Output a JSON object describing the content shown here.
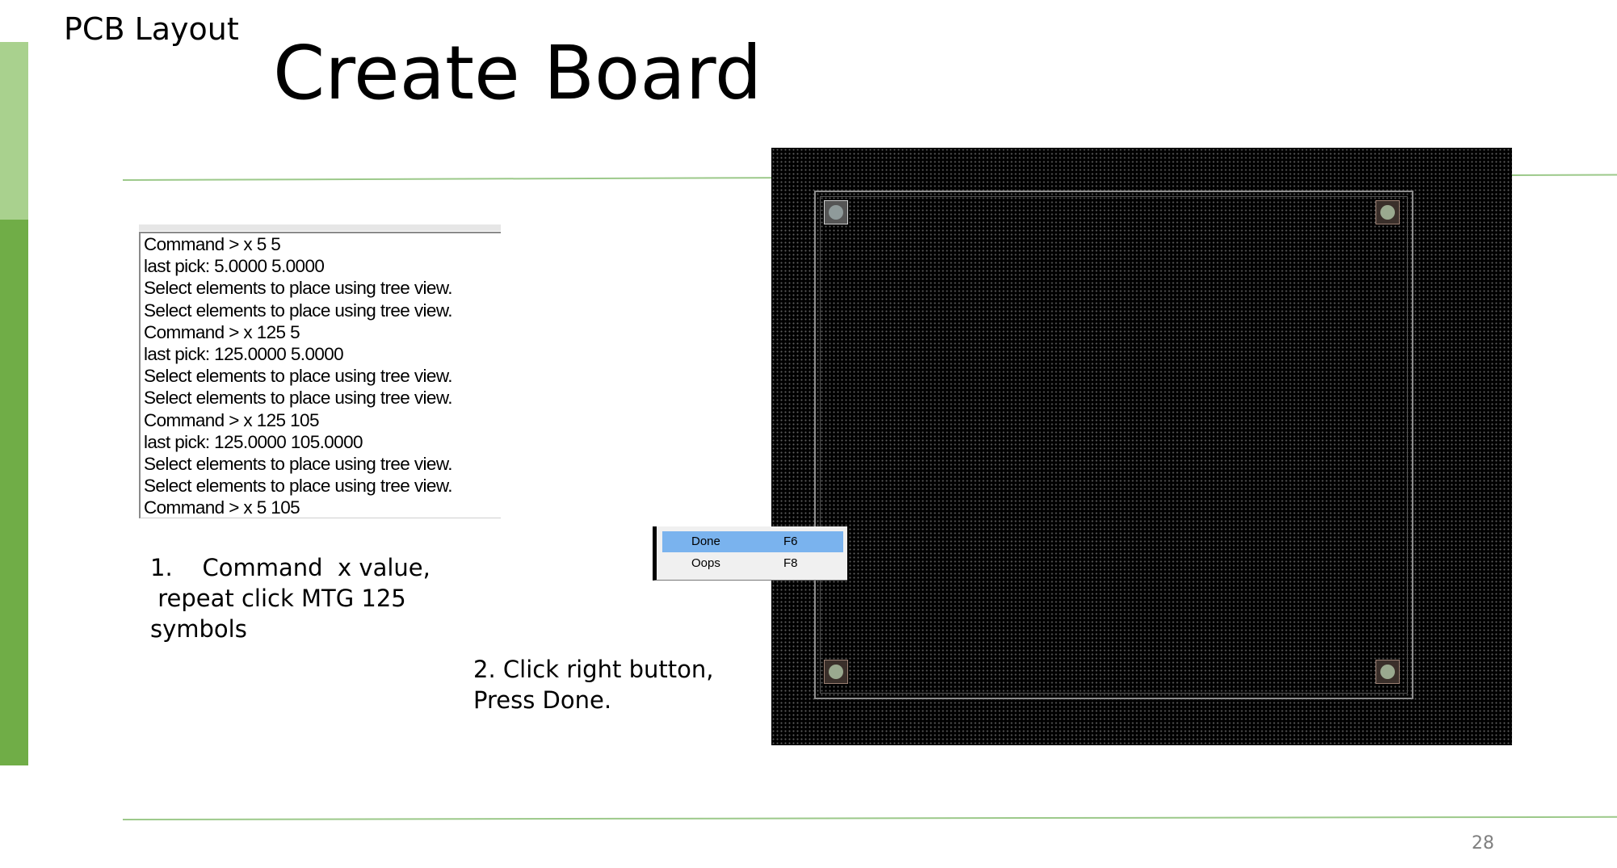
{
  "slide": {
    "header_label": "PCB Layout",
    "title": "Create Board",
    "page_number": "28"
  },
  "command_window": {
    "lines": [
      "Command > x 5 5",
      "last pick:  5.0000 5.0000",
      "Select elements to place using tree view.",
      "Select elements to place using tree view.",
      "Command > x 125 5",
      "last pick:  125.0000 5.0000",
      "Select elements to place using tree view.",
      "Select elements to place using tree view.",
      "Command > x 125 105",
      "last pick:  125.0000 105.0000",
      "Select elements to place using tree view.",
      "Select elements to place using tree view.",
      "Command > x 5 105"
    ]
  },
  "steps": {
    "step1": {
      "line1": "1.    Command  x value,",
      "line2": " repeat click MTG 125",
      "line3": "symbols"
    },
    "step2": {
      "line1": "2. Click right button,",
      "line2": "Press Done."
    }
  },
  "context_menu": {
    "items": [
      {
        "label": "Done",
        "shortcut": "F6",
        "active": true
      },
      {
        "label": "Oops",
        "shortcut": "F8",
        "active": false
      }
    ]
  },
  "pcb_view": {
    "background": "#000000",
    "grid_dot_color": "#5e5e5e",
    "outline_color": "#8c8c8c"
  },
  "colors": {
    "accent_light": "#a9d18e",
    "accent_dark": "#70ad47",
    "menu_highlight": "#7ab3ee"
  }
}
